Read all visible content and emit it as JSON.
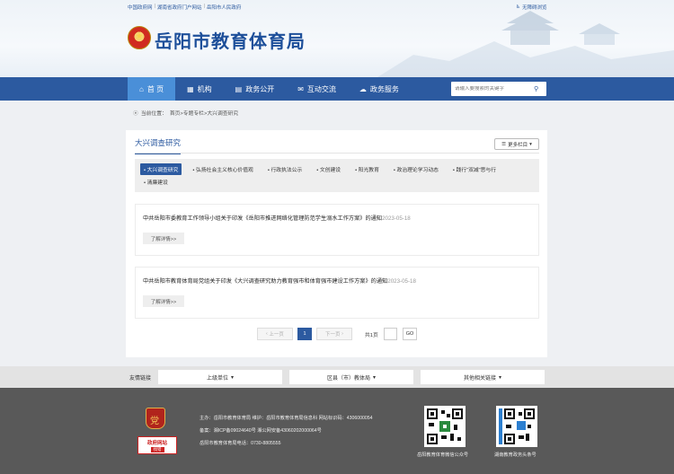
{
  "header": {
    "top_links": [
      "中国政府网",
      "湖南省政府门户网站",
      "岳阳市人民政府"
    ],
    "accessibility_label": "无障碍浏览",
    "site_title": "岳阳市教育体育局"
  },
  "nav": {
    "items": [
      {
        "label": "首 页",
        "icon": "home-icon"
      },
      {
        "label": "机构",
        "icon": "building-icon"
      },
      {
        "label": "政务公开",
        "icon": "document-icon"
      },
      {
        "label": "互动交流",
        "icon": "chat-icon"
      },
      {
        "label": "政务服务",
        "icon": "service-icon"
      }
    ],
    "search_placeholder": "请输入要搜索的关键字"
  },
  "breadcrumb": {
    "label": "当前位置：",
    "path": "首页>专题专栏>大兴调查研究"
  },
  "column": {
    "title": "大兴调查研究",
    "more_label": "更多栏目",
    "tabs": [
      "• 大兴调查研究",
      "• 弘扬社会主义核心价值观",
      "• 行政执法公示",
      "• 文创建设",
      "• 阳光教育",
      "• 政治理论学习动态",
      "• 践行“双减”思与行",
      "• 清廉建设"
    ],
    "active_tab": 0
  },
  "articles": [
    {
      "title": "中共岳阳市委教育工作领导小组关于印发《岳阳市推进网络化管理防范学生溺水工作方案》的通知",
      "date": "2023-05-18",
      "button": "了解详情>>"
    },
    {
      "title": "中共岳阳市教育体育局党组关于印发《大兴调查研究助力教育强市和体育强市建设工作方案》的通知",
      "date": "2023-05-18",
      "button": "了解详情>>"
    }
  ],
  "pagination": {
    "prev": "上一页",
    "current": "1",
    "next": "下一页",
    "total": "共1页",
    "go": "GO"
  },
  "friend_links": {
    "label": "友情链接",
    "dropdowns": [
      "上级单位",
      "区县（市）教体局",
      "其他相关链接"
    ]
  },
  "footer": {
    "host": "主办：岳阳市教育体育局   维护：岳阳市教育体育局信息科   网站标识码：4306000054",
    "icp": "备案：湘ICP备09024640号    湘公网安备43060202000064号",
    "phone": "岳阳市教育体育局电话：0730-8805555",
    "badge2_top": "政府网站",
    "badge2_bottom": "找错",
    "qr_captions": [
      "岳阳教育体育微信公众号",
      "湖南教育政务头条号"
    ]
  },
  "colors": {
    "primary": "#2c5aa0",
    "nav_active": "#4a8fd8",
    "footer_bg": "#595959"
  }
}
